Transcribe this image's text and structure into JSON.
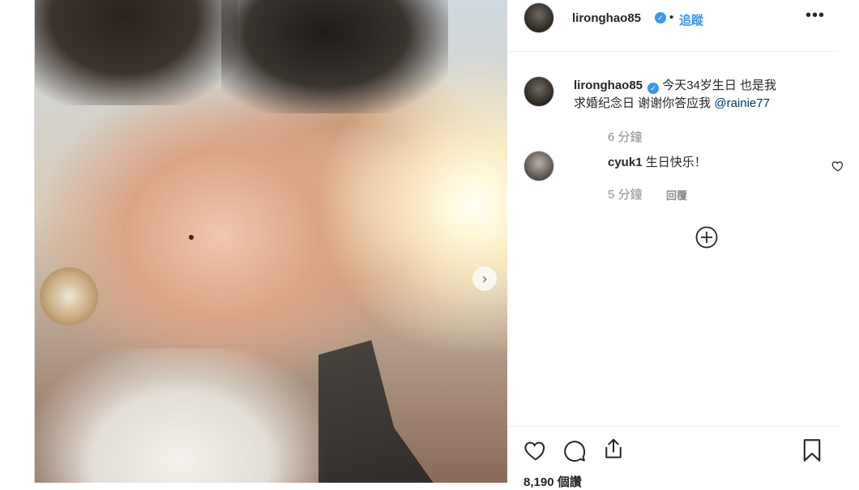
{
  "post": {
    "author": "lironghao85",
    "follow_label": "追蹤",
    "separator": "•",
    "more_label": "•••"
  },
  "caption": {
    "username": "lironghao85",
    "text_line1": "今天34岁生日 也是我",
    "text_line2": "求婚纪念日 谢谢你答应我 ",
    "mention": "@rainie77",
    "time": "6 分鐘"
  },
  "comments": [
    {
      "username": "cyuk1",
      "text": "生日快乐！",
      "time": "5 分鐘",
      "reply_label": "回覆"
    }
  ],
  "photo": {
    "next_glyph": "›"
  },
  "footer": {
    "views": "8,190 個讚"
  },
  "colors": {
    "accent": "#3897f0",
    "text": "#262626",
    "muted": "#8e8e8e",
    "border": "#dbdbdb"
  },
  "icons": [
    "verified-badge-icon",
    "more-options-icon",
    "heart-icon",
    "comment-icon",
    "share-icon",
    "bookmark-icon",
    "load-more-icon",
    "chevron-right-icon"
  ]
}
